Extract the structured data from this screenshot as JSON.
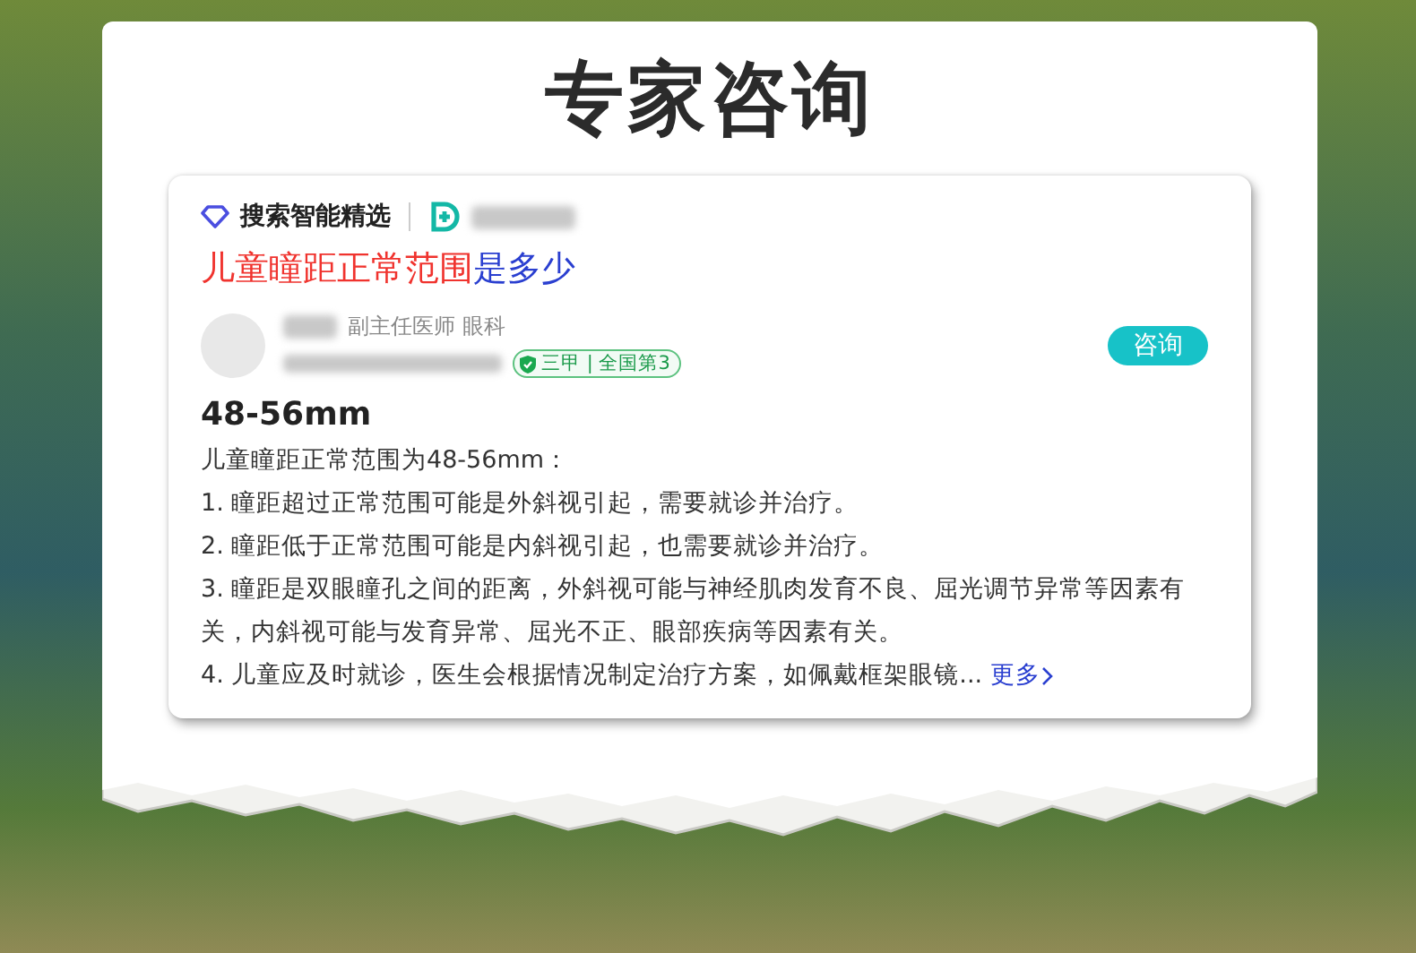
{
  "page_title": "专家咨询",
  "card": {
    "source_label": "搜索智能精选",
    "question": {
      "highlight": "儿童瞳距正常范围",
      "rest": "是多少"
    },
    "doctor": {
      "title": "副主任医师 眼科",
      "badge": "三甲 | 全国第3",
      "consult_button": "咨询"
    },
    "answer": "48-56mm",
    "intro": "儿童瞳距正常范围为48-56mm：",
    "points": [
      "1. 瞳距超过正常范围可能是外斜视引起，需要就诊并治疗。",
      "2. 瞳距低于正常范围可能是内斜视引起，也需要就诊并治疗。",
      "3. 瞳距是双眼瞳孔之间的距离，外斜视可能与神经肌肉发育不良、屈光调节异常等因素有关，内斜视可能与发育异常、屈光不正、眼部疾病等因素有关。",
      "4. 儿童应及时就诊，医生会根据情况制定治疗方案，如佩戴框架眼镜..."
    ],
    "more_link": "更多"
  }
}
